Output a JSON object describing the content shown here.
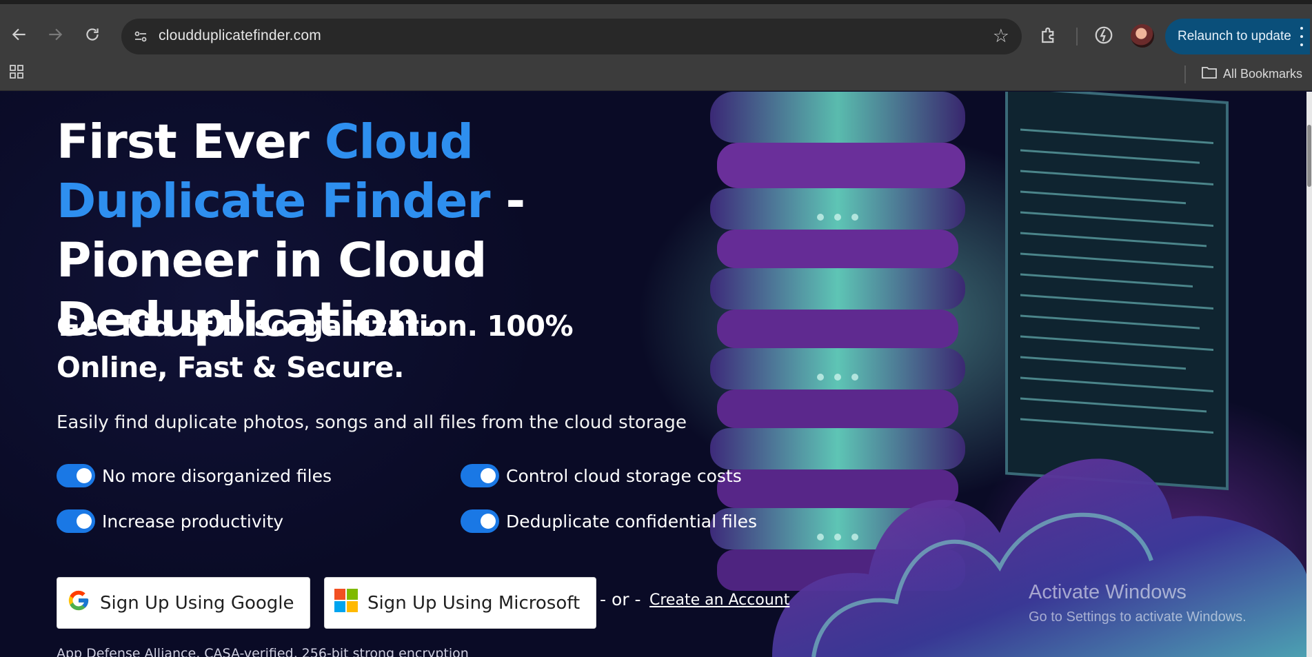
{
  "browser": {
    "url": "cloudduplicatefinder.com",
    "relaunch_label": "Relaunch to update",
    "bookmarks_label": "All Bookmarks"
  },
  "hero": {
    "title_part1": "First Ever ",
    "title_accent": "Cloud Duplicate Finder",
    "title_part2": " - Pioneer in Cloud Deduplication.",
    "subtitle": "Get Rid of Disorganization. 100% Online, Fast & Secure.",
    "description": "Easily find duplicate photos, songs and all files from the cloud storage",
    "features": [
      "No more disorganized files",
      "Control cloud storage costs",
      "Increase productivity",
      "Deduplicate confidential files"
    ],
    "google_button": "Sign Up Using Google",
    "microsoft_button": "Sign Up Using Microsoft",
    "or_text": "- or -",
    "create_account": "Create an Account",
    "footnote": "App Defense Alliance, CASA-verified, 256-bit strong encryption"
  },
  "watermark": {
    "line1": "Activate Windows",
    "line2": "Go to Settings to activate Windows."
  },
  "colors": {
    "accent_blue": "#2e8fef",
    "toggle_blue": "#1a78e5",
    "page_bg": "#0a0b26",
    "relaunch_bg": "#0a4f7a"
  },
  "icons": [
    "back-arrow-icon",
    "forward-arrow-icon",
    "reload-icon",
    "site-info-icon",
    "star-icon",
    "extensions-icon",
    "performance-icon",
    "kebab-menu-icon",
    "apps-grid-icon",
    "folder-icon",
    "google-logo",
    "microsoft-logo"
  ]
}
